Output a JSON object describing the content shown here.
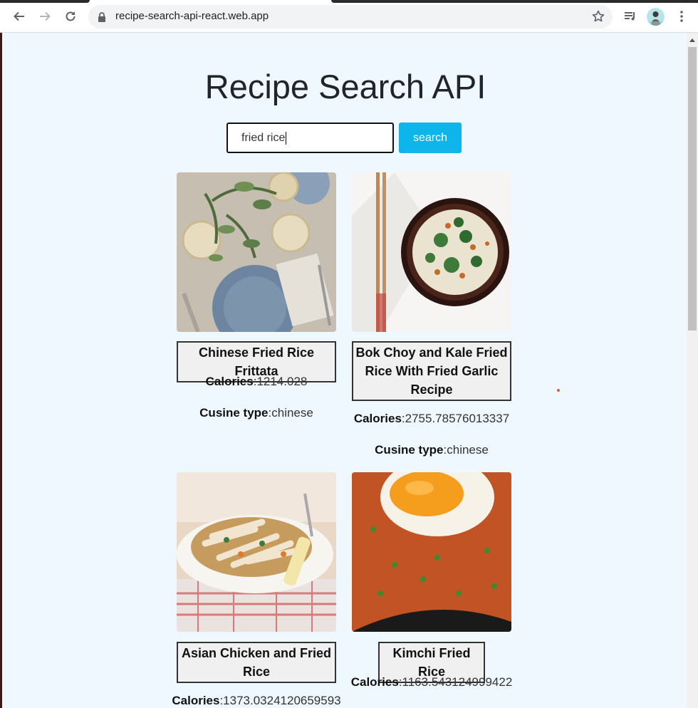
{
  "browser": {
    "url": "recipe-search-api-react.web.app",
    "icons": [
      "back-icon",
      "forward-icon",
      "reload-icon",
      "lock-icon",
      "star-icon",
      "media-queue-icon",
      "profile-avatar",
      "menu-icon"
    ]
  },
  "page": {
    "title": "Recipe Search API",
    "search": {
      "value": "fried rice",
      "button_label": "search"
    },
    "accent_color": "#0db5ea",
    "background_color": "#f0f8ff",
    "labels": {
      "calories": "Calories",
      "cuisine": "Cusine type"
    },
    "recipes": [
      {
        "name": "Chinese Fried Rice Frittata",
        "calories": ":1214.028",
        "cuisine": ":chinese"
      },
      {
        "name": "Bok Choy and Kale Fried Rice With Fried Garlic Recipe",
        "calories": ":2755.78576013337",
        "cuisine": ":chinese"
      },
      {
        "name": "Asian Chicken and Fried Rice",
        "calories": ":1373.0324120659593",
        "cuisine": ""
      },
      {
        "name": "Kimchi Fried Rice",
        "calories": ":1163.543124999422",
        "cuisine": ""
      }
    ]
  }
}
